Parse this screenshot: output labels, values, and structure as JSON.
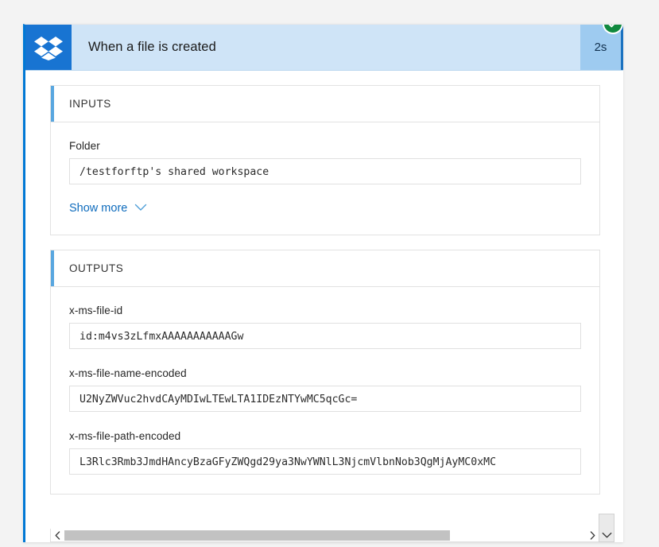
{
  "card": {
    "connector_icon": "dropbox-icon",
    "title": "When a file is created",
    "duration": "2s",
    "status": "succeeded",
    "status_icon": "check-circle-icon",
    "accent_color": "#0078d4",
    "header_bg": "#cfe4f7",
    "duration_bg": "#9ecbf0",
    "status_color": "#10893e",
    "connector_bg": "#1874d2"
  },
  "inputs": {
    "title": "INPUTS",
    "fields": [
      {
        "label": "Folder",
        "value": "/testforftp's shared workspace"
      }
    ],
    "show_more_label": "Show more",
    "show_more_icon": "chevron-down-icon"
  },
  "outputs": {
    "title": "OUTPUTS",
    "fields": [
      {
        "label": "x-ms-file-id",
        "value": "id:m4vs3zLfmxAAAAAAAAAAAGw"
      },
      {
        "label": "x-ms-file-name-encoded",
        "value": "U2NyZWVuc2hvdCAyMDIwLTEwLTA1IDEzNTYwMC5qcGc="
      },
      {
        "label": "x-ms-file-path-encoded",
        "value": "L3Rlc3Rmb3JmdHAncyBzaGFyZWQgd29ya3NwYWNlL3NjcmVlbnNob3QgMjAyMC0xMC"
      }
    ],
    "scrollbar": {
      "left_arrow_icon": "chevron-left-icon",
      "right_arrow_icon": "chevron-right-icon",
      "thumb_position": "left"
    }
  },
  "page_scroll": {
    "down_icon": "chevron-down-icon"
  }
}
